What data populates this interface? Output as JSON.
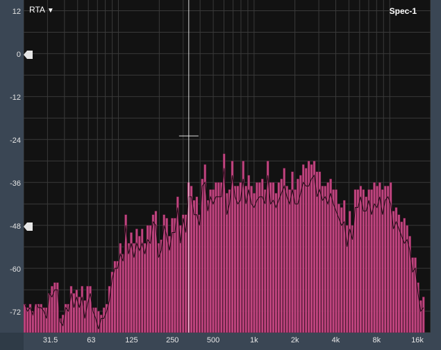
{
  "header": {
    "mode_label": "RTA",
    "mode_arrow": "▼",
    "title": "Spec-1"
  },
  "y_axis": {
    "labels": [
      "12",
      "0",
      "-12",
      "-24",
      "-36",
      "-48",
      "-60",
      "-72"
    ],
    "range_db": [
      -78,
      15
    ]
  },
  "x_axis": {
    "labels": [
      "31.5",
      "63",
      "125",
      "250",
      "500",
      "1k",
      "2k",
      "4k",
      "8k",
      "16k"
    ]
  },
  "markers": {
    "upper_db": 0,
    "lower_db": -48
  },
  "cursor": {
    "freq_hz": 330,
    "peak_db": -23
  },
  "colors": {
    "bars": "#c0457f",
    "bar_edge": "#5a1538",
    "background": "#121212",
    "grid": "#3a3a3a",
    "trace": "#1a0a12"
  },
  "chart_data": {
    "type": "bar",
    "title": "",
    "xlabel": "",
    "ylabel": "",
    "x_scale": "log",
    "xlim_hz": [
      20,
      20000
    ],
    "ylim_db": [
      -78,
      15
    ],
    "series": [
      {
        "freq_hz": [
          20,
          21,
          22,
          23,
          24,
          26,
          27,
          28,
          29,
          31,
          32,
          34,
          35,
          37,
          39,
          41,
          43,
          45,
          47,
          49,
          51,
          54,
          56,
          59,
          62,
          65,
          68,
          71,
          74,
          78,
          82,
          86,
          90,
          94,
          99,
          103,
          108,
          113,
          119,
          125,
          131,
          137,
          144,
          151,
          158,
          165,
          173,
          182,
          190,
          200,
          209,
          219,
          230,
          241,
          252,
          264,
          277,
          290,
          304,
          318,
          334,
          350,
          366,
          384,
          402,
          421,
          441,
          462,
          484,
          508,
          532,
          557,
          584,
          611,
          640,
          671,
          703,
          737,
          772,
          808,
          847,
          887,
          929,
          974,
          1020,
          1069,
          1120,
          1173,
          1229,
          1288,
          1349,
          1413,
          1481,
          1551,
          1625,
          1702,
          1783,
          1868,
          1957,
          2051,
          2148,
          2251,
          2358,
          2470,
          2588,
          2711,
          2840,
          2975,
          3117,
          3266,
          3421,
          3584,
          3755,
          3934,
          4121,
          4318,
          4523,
          4739,
          4964,
          5201,
          5449,
          5708,
          5980,
          6265,
          6563,
          6876,
          7204,
          7547,
          7906,
          8283,
          8678,
          9091,
          9524,
          9978,
          10453,
          10951,
          11473,
          12019,
          12592,
          13191,
          13820,
          14478,
          15168,
          15890,
          16647,
          17440,
          18271,
          19141,
          20053
        ],
        "level_db": [
          -70,
          -71,
          -70,
          -72,
          -70,
          -70,
          -70,
          -71,
          -71,
          -67,
          -65,
          -64,
          -64,
          -74,
          -73,
          -70,
          -70,
          -65,
          -67,
          -66,
          -68,
          -65,
          -69,
          -65,
          -65,
          -71,
          -71,
          -72,
          -73,
          -71,
          -70,
          -65,
          -61,
          -58,
          -58,
          -53,
          -56,
          -45,
          -53,
          -50,
          -53,
          -49,
          -51,
          -49,
          -53,
          -48,
          -48,
          -45,
          -44,
          -53,
          -52,
          -45,
          -46,
          -51,
          -46,
          -46,
          -40,
          -48,
          -45,
          -45,
          -36,
          -37,
          -41,
          -40,
          -45,
          -35,
          -31,
          -41,
          -38,
          -38,
          -36,
          -36,
          -36,
          -28,
          -39,
          -38,
          -30,
          -37,
          -37,
          -36,
          -30,
          -37,
          -34,
          -37,
          -39,
          -36,
          -36,
          -35,
          -38,
          -30,
          -36,
          -36,
          -39,
          -36,
          -35,
          -32,
          -37,
          -38,
          -33,
          -38,
          -35,
          -34,
          -31,
          -32,
          -30,
          -31,
          -30,
          -33,
          -33,
          -37,
          -37,
          -36,
          -35,
          -38,
          -38,
          -42,
          -43,
          -41,
          -48,
          -44,
          -48,
          -38,
          -38,
          -37,
          -38,
          -40,
          -38,
          -38,
          -36,
          -37,
          -36,
          -38,
          -37,
          -37,
          -36,
          -44,
          -43,
          -45,
          -47,
          -46,
          -48,
          -51,
          -57,
          -57,
          -64,
          -69,
          -68
        ],
        "trace_db": [
          -70,
          -72,
          -71,
          -73,
          -69,
          -71,
          -71,
          -72,
          -74,
          -67,
          -68,
          -66,
          -66,
          -75,
          -76,
          -71,
          -72,
          -67,
          -71,
          -68,
          -71,
          -68,
          -74,
          -70,
          -67,
          -72,
          -74,
          -77,
          -74,
          -74,
          -72,
          -69,
          -63,
          -60,
          -60,
          -56,
          -58,
          -48,
          -56,
          -53,
          -57,
          -53,
          -55,
          -53,
          -56,
          -52,
          -53,
          -47,
          -48,
          -57,
          -55,
          -48,
          -51,
          -55,
          -50,
          -50,
          -43,
          -53,
          -46,
          -50,
          -40,
          -40,
          -45,
          -45,
          -48,
          -37,
          -36,
          -44,
          -40,
          -42,
          -40,
          -40,
          -40,
          -32,
          -45,
          -42,
          -34,
          -40,
          -42,
          -41,
          -35,
          -42,
          -38,
          -42,
          -43,
          -41,
          -40,
          -40,
          -42,
          -34,
          -42,
          -41,
          -43,
          -41,
          -39,
          -37,
          -40,
          -42,
          -38,
          -42,
          -42,
          -39,
          -36,
          -37,
          -37,
          -35,
          -34,
          -40,
          -38,
          -41,
          -40,
          -42,
          -39,
          -42,
          -44,
          -46,
          -48,
          -47,
          -54,
          -49,
          -52,
          -43,
          -43,
          -40,
          -44,
          -44,
          -41,
          -45,
          -42,
          -43,
          -40,
          -45,
          -41,
          -40,
          -42,
          -49,
          -47,
          -49,
          -51,
          -53,
          -52,
          -55,
          -61,
          -60,
          -67,
          -72,
          -71
        ]
      }
    ]
  }
}
